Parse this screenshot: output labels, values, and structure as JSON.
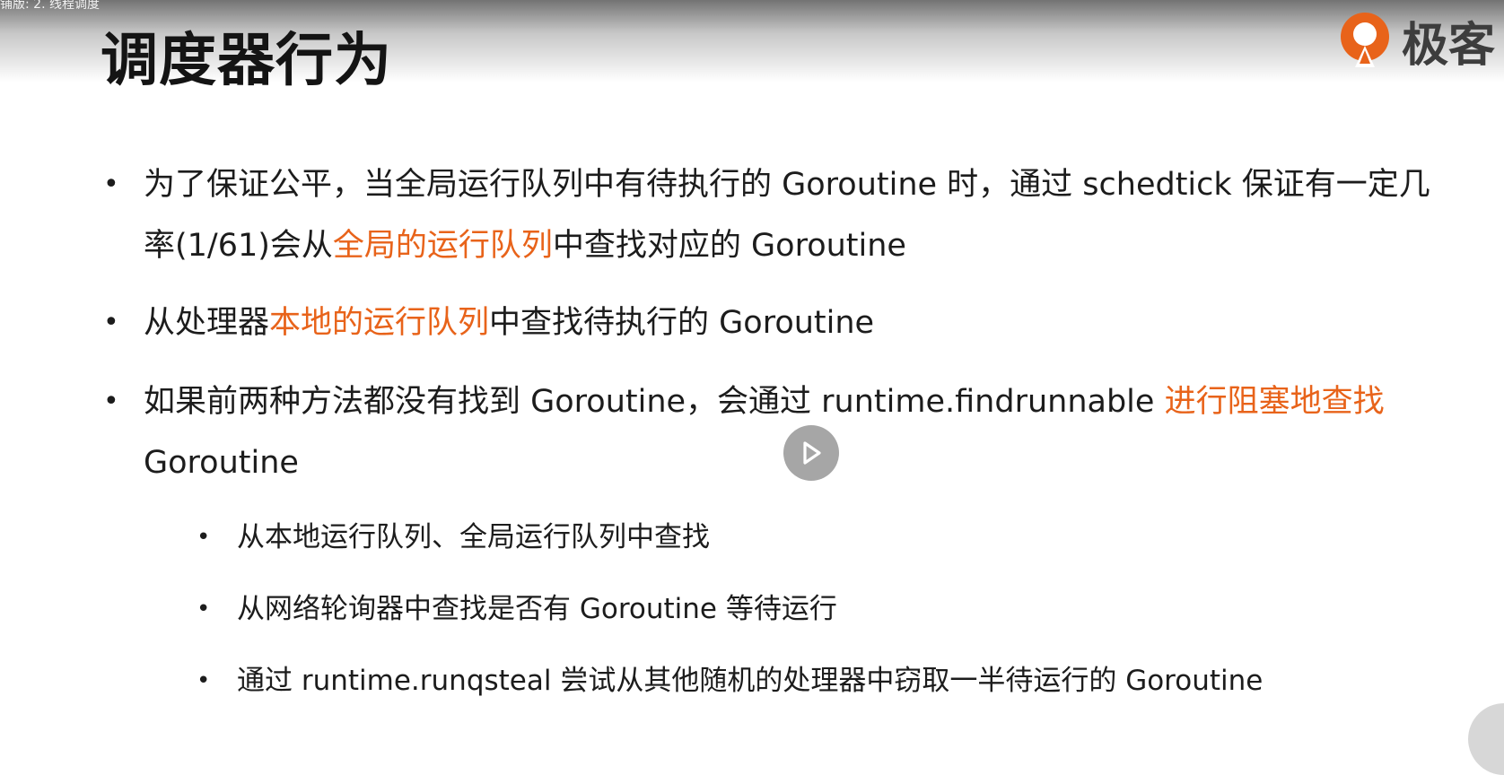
{
  "video": {
    "caption": "铺版: 2. 线程调度"
  },
  "slide": {
    "title": "调度器行为",
    "logo_text": "极客",
    "accent_color": "#e8631a",
    "bullets": [
      {
        "segments": [
          {
            "text": "为了保证公平，当全局运行队列中有待执行的 Goroutine 时，通过 schedtick 保证有一定几率(1/61)会从"
          },
          {
            "text": "全局的运行队列",
            "highlight": true
          },
          {
            "text": "中查找对应的 Goroutine"
          }
        ]
      },
      {
        "segments": [
          {
            "text": "从处理器"
          },
          {
            "text": "本地的运行队列",
            "highlight": true
          },
          {
            "text": "中查找待执行的 Goroutine"
          }
        ]
      },
      {
        "segments": [
          {
            "text": "如果前两种方法都没有找到 Goroutine，会通过 runtime.findrunnable "
          },
          {
            "text": "进行阻塞地查找",
            "highlight": true
          },
          {
            "text": " Goroutine"
          }
        ]
      }
    ],
    "sub_bullets": [
      "从本地运行队列、全局运行队列中查找",
      "从网络轮询器中查找是否有 Goroutine 等待运行",
      "通过 runtime.runqsteal 尝试从其他随机的处理器中窃取一半待运行的 Goroutine"
    ]
  },
  "icons": {
    "play": "play-icon",
    "logo": "geekbang-logo-icon"
  }
}
